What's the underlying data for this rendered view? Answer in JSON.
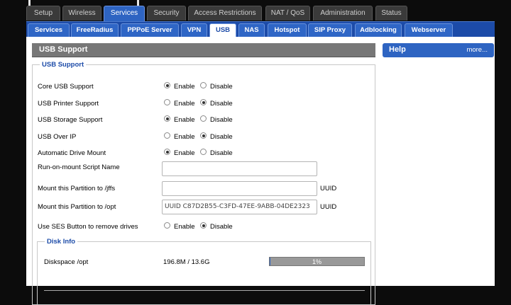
{
  "top_tabs": [
    {
      "label": "Setup"
    },
    {
      "label": "Wireless"
    },
    {
      "label": "Services",
      "active": true
    },
    {
      "label": "Security"
    },
    {
      "label": "Access Restrictions"
    },
    {
      "label": "NAT / QoS"
    },
    {
      "label": "Administration"
    },
    {
      "label": "Status"
    }
  ],
  "sub_tabs": [
    {
      "label": "Services"
    },
    {
      "label": "FreeRadius"
    },
    {
      "label": "PPPoE Server"
    },
    {
      "label": "VPN"
    },
    {
      "label": "USB",
      "active": true
    },
    {
      "label": "NAS"
    },
    {
      "label": "Hotspot"
    },
    {
      "label": "SIP Proxy"
    },
    {
      "label": "Adblocking"
    },
    {
      "label": "Webserver"
    }
  ],
  "section_title": "USB Support",
  "fieldset_legend": "USB Support",
  "radio_labels": {
    "enable": "Enable",
    "disable": "Disable"
  },
  "settings": [
    {
      "label": "Core USB Support",
      "value": "Enable"
    },
    {
      "label": "USB Printer Support",
      "value": "Disable"
    },
    {
      "label": "USB Storage Support",
      "value": "Enable"
    },
    {
      "label": "USB Over IP",
      "value": "Disable"
    },
    {
      "label": "Automatic Drive Mount",
      "value": "Enable"
    }
  ],
  "script_name": {
    "label": "Run-on-mount Script Name",
    "value": ""
  },
  "jffs": {
    "label": "Mount this Partition to /jffs",
    "value": "",
    "suffix": "UUID"
  },
  "opt": {
    "label": "Mount this Partition to /opt",
    "value": "UUID C87D2B55-C3FD-47EE-9ABB-04DE2323",
    "suffix": "UUID"
  },
  "ses": {
    "label": "Use SES Button to remove drives",
    "value": "Disable"
  },
  "disk_info": {
    "legend": "Disk Info",
    "label": "Diskspace /opt",
    "space": "196.8M / 13.6G",
    "percent": 1,
    "percent_text": "1%"
  },
  "help": {
    "title": "Help",
    "more": "more..."
  },
  "colors": {
    "accent": "#2e64c2",
    "nav_dark": "#1c4ba8",
    "header_gray": "#777777"
  }
}
